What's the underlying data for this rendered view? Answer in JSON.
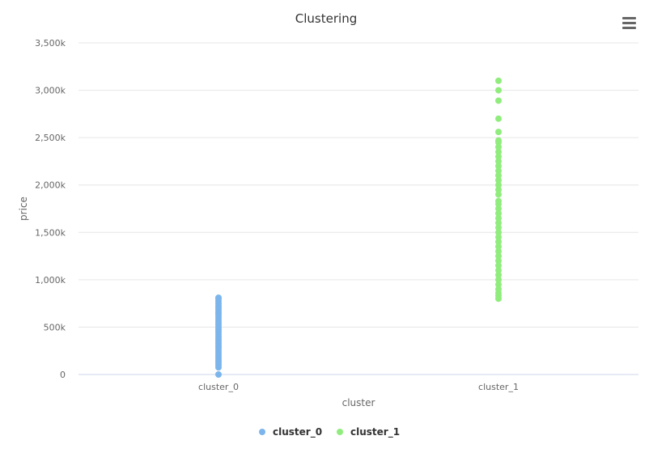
{
  "chart_data": {
    "type": "scatter",
    "title": "Clustering",
    "xlabel": "cluster",
    "ylabel": "price",
    "categories": [
      "cluster_0",
      "cluster_1"
    ],
    "ylim": [
      0,
      3500000
    ],
    "y_ticks": [
      "0",
      "500k",
      "1,000k",
      "1,500k",
      "2,000k",
      "2,500k",
      "3,000k",
      "3,500k"
    ],
    "grid": true,
    "legend_position": "bottom-center",
    "series": [
      {
        "name": "cluster_0",
        "color": "#7cb5ec",
        "category": "cluster_0",
        "values": [
          0,
          75000,
          100000,
          125000,
          150000,
          175000,
          200000,
          225000,
          250000,
          275000,
          300000,
          325000,
          350000,
          375000,
          400000,
          425000,
          450000,
          475000,
          500000,
          525000,
          550000,
          575000,
          600000,
          625000,
          650000,
          675000,
          700000,
          725000,
          750000,
          775000,
          800000,
          810000
        ]
      },
      {
        "name": "cluster_1",
        "color": "#90ed7d",
        "category": "cluster_1",
        "values": [
          800000,
          830000,
          860000,
          900000,
          950000,
          1000000,
          1050000,
          1100000,
          1150000,
          1200000,
          1250000,
          1300000,
          1350000,
          1400000,
          1450000,
          1500000,
          1550000,
          1600000,
          1650000,
          1700000,
          1750000,
          1800000,
          1830000,
          1900000,
          1950000,
          2000000,
          2050000,
          2100000,
          2150000,
          2200000,
          2250000,
          2300000,
          2350000,
          2400000,
          2450000,
          2470000,
          2560000,
          2700000,
          2890000,
          3000000,
          3100000
        ]
      }
    ]
  },
  "menu": {
    "icon": "hamburger-menu-icon"
  }
}
